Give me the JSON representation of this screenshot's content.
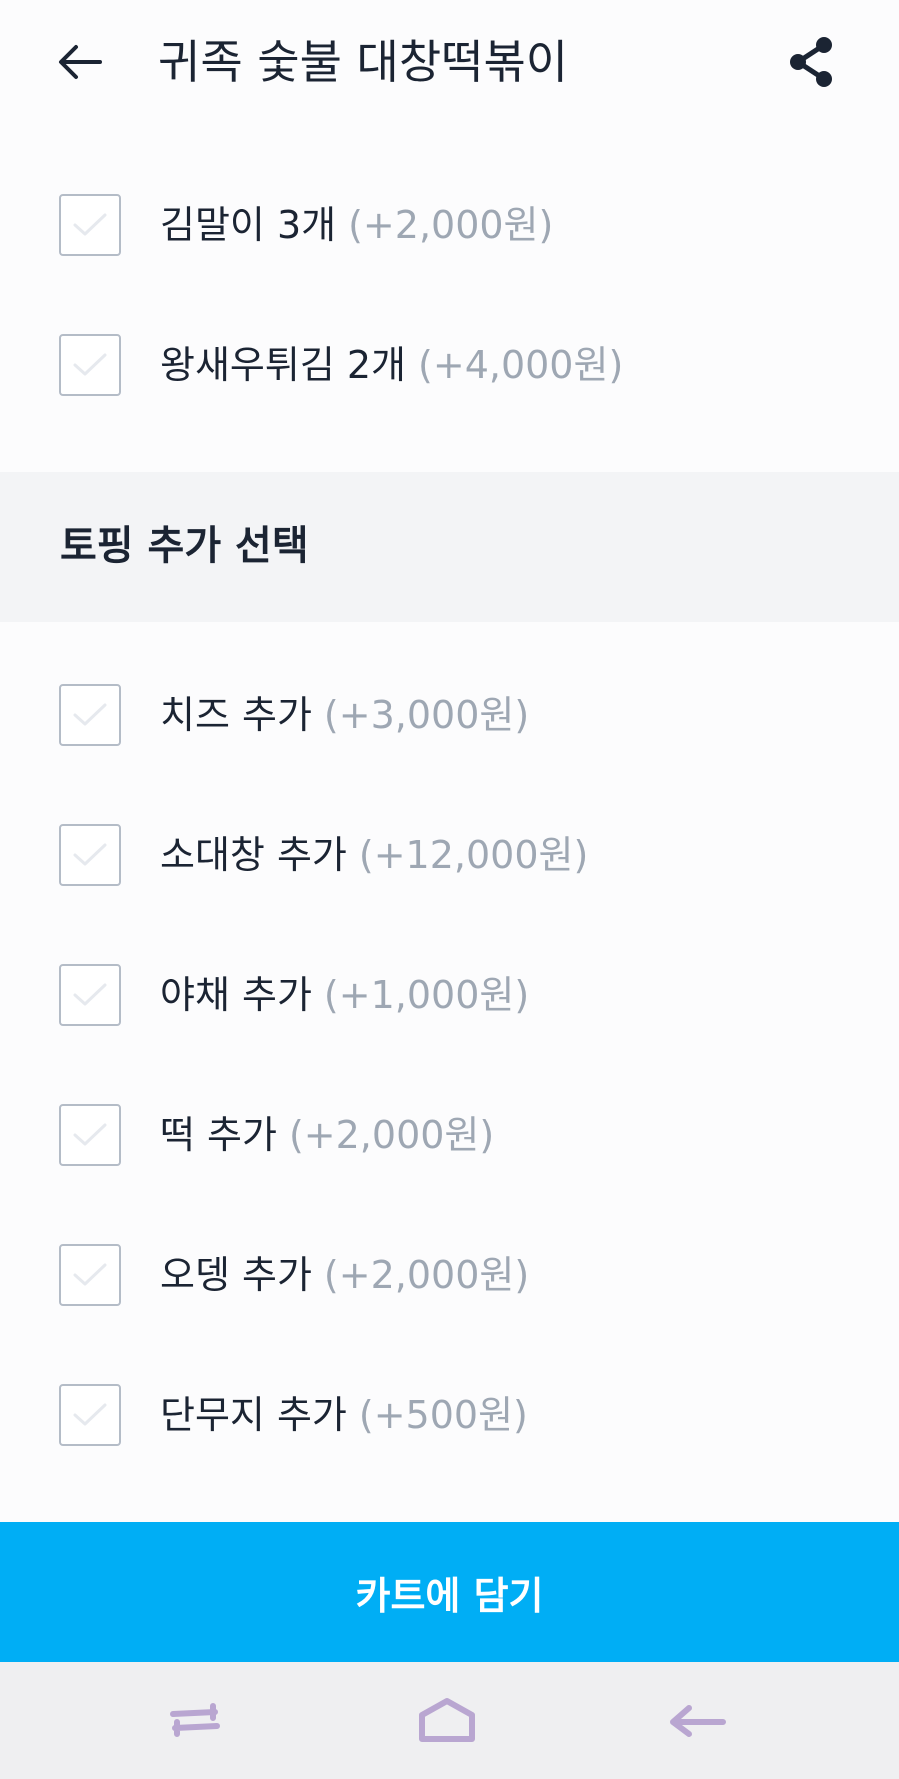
{
  "header": {
    "title": "귀족 숯불 대창떡볶이",
    "back_icon": "arrow-left-icon",
    "share_icon": "share-icon"
  },
  "options_group_1": [
    {
      "name": "김말이 3개",
      "price": "(+2,000원)"
    },
    {
      "name": "왕새우튀김 2개",
      "price": "(+4,000원)"
    }
  ],
  "topping_section": {
    "title": "토핑 추가 선택"
  },
  "options_group_2": [
    {
      "name": "치즈 추가",
      "price": "(+3,000원)"
    },
    {
      "name": "소대창 추가",
      "price": "(+12,000원)"
    },
    {
      "name": "야채 추가",
      "price": "(+1,000원)"
    },
    {
      "name": "떡 추가",
      "price": "(+2,000원)"
    },
    {
      "name": "오뎅 추가",
      "price": "(+2,000원)"
    },
    {
      "name": "단무지 추가",
      "price": "(+500원)"
    }
  ],
  "cart_button": {
    "label": "카트에 담기"
  },
  "navbar": {
    "recents_icon": "recents-icon",
    "home_icon": "home-icon",
    "back_icon": "nav-back-icon"
  },
  "colors": {
    "accent": "#00aef5",
    "text": "#1b2433",
    "price_text": "#9ea7b3",
    "section_bg": "#f3f4f6",
    "nav_icon": "#b9a6d1"
  }
}
